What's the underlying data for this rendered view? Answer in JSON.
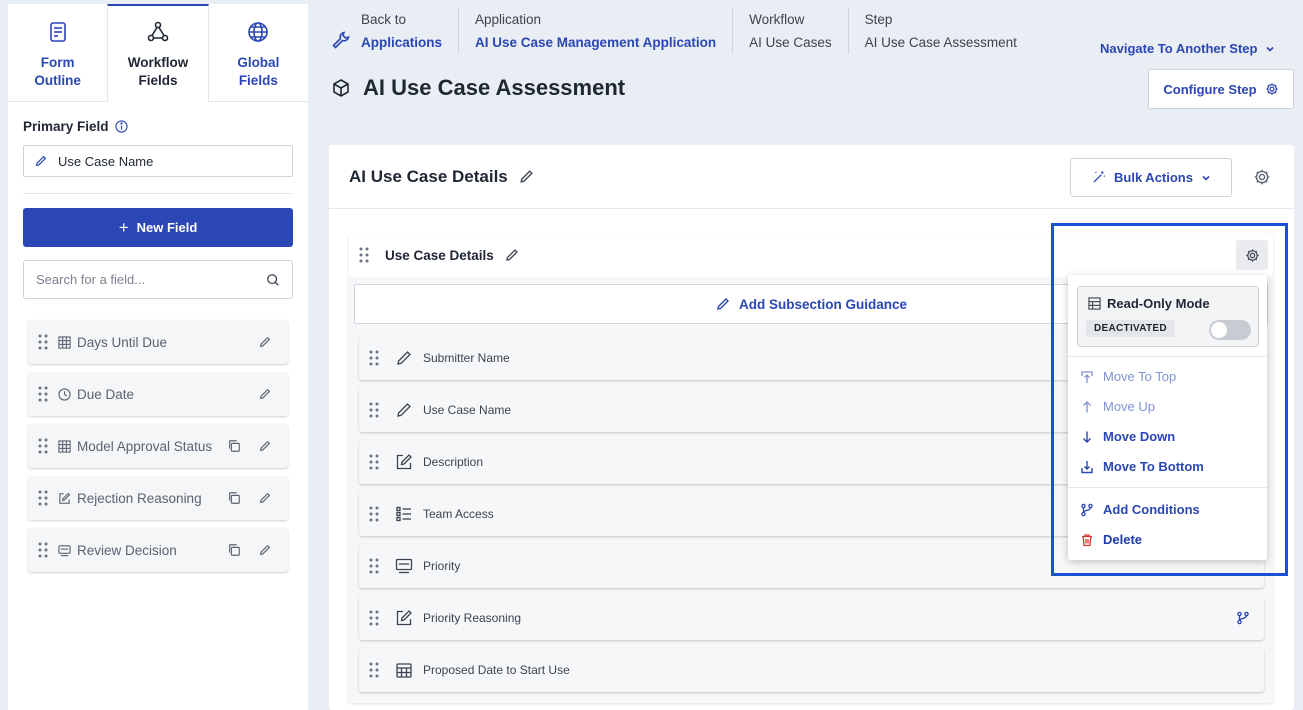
{
  "sidebar": {
    "tabs": [
      {
        "label_line1": "Form",
        "label_line2": "Outline",
        "icon": "document-icon"
      },
      {
        "label_line1": "Workflow",
        "label_line2": "Fields",
        "icon": "workflow-icon"
      },
      {
        "label_line1": "Global",
        "label_line2": "Fields",
        "icon": "globe-icon"
      }
    ],
    "primary_field_label": "Primary Field",
    "primary_field_value": "Use Case Name",
    "new_field_label": "New Field",
    "search_placeholder": "Search for a field...",
    "fields": [
      {
        "label": "Days Until Due",
        "icon": "table-icon",
        "copy": false
      },
      {
        "label": "Due Date",
        "icon": "clock-icon",
        "copy": false
      },
      {
        "label": "Model Approval Status",
        "icon": "table-icon",
        "copy": true
      },
      {
        "label": "Rejection Reasoning",
        "icon": "edit-box-icon",
        "copy": true
      },
      {
        "label": "Review Decision",
        "icon": "monitor-icon",
        "copy": true
      }
    ]
  },
  "breadcrumb": [
    {
      "top": "Back to",
      "bottom": "Applications",
      "link": true
    },
    {
      "top": "Application",
      "bottom": "AI Use Case Management Application",
      "link": true
    },
    {
      "top": "Workflow",
      "bottom": "AI Use Cases",
      "link": false
    },
    {
      "top": "Step",
      "bottom": "AI Use Case Assessment",
      "link": false
    }
  ],
  "header": {
    "navigate_label": "Navigate To Another Step",
    "title": "AI Use Case Assessment",
    "configure_label": "Configure Step"
  },
  "card": {
    "title": "AI Use Case Details",
    "bulk_actions_label": "Bulk Actions"
  },
  "section": {
    "title": "Use Case Details",
    "guidance_label": "Add Subsection Guidance",
    "rows": [
      {
        "label": "Submitter Name",
        "icon": "pencil-icon",
        "branch": false
      },
      {
        "label": "Use Case Name",
        "icon": "pencil-icon",
        "branch": false
      },
      {
        "label": "Description",
        "icon": "edit-box-icon",
        "branch": false
      },
      {
        "label": "Team Access",
        "icon": "list-icon",
        "branch": false
      },
      {
        "label": "Priority",
        "icon": "monitor-icon",
        "branch": false
      },
      {
        "label": "Priority Reasoning",
        "icon": "edit-box-icon",
        "branch": true
      },
      {
        "label": "Proposed Date to Start Use",
        "icon": "calendar-icon",
        "branch": false
      }
    ]
  },
  "menu": {
    "read_only_title": "Read-Only Mode",
    "read_only_status": "DEACTIVATED",
    "read_only_enabled": false,
    "move_to_top": "Move To Top",
    "move_up": "Move Up",
    "move_down": "Move Down",
    "move_to_bottom": "Move To Bottom",
    "add_conditions": "Add Conditions",
    "delete": "Delete"
  },
  "colors": {
    "accent": "#2b46b5",
    "highlight": "#1a4fd6",
    "delete_icon": "#d9362b"
  }
}
